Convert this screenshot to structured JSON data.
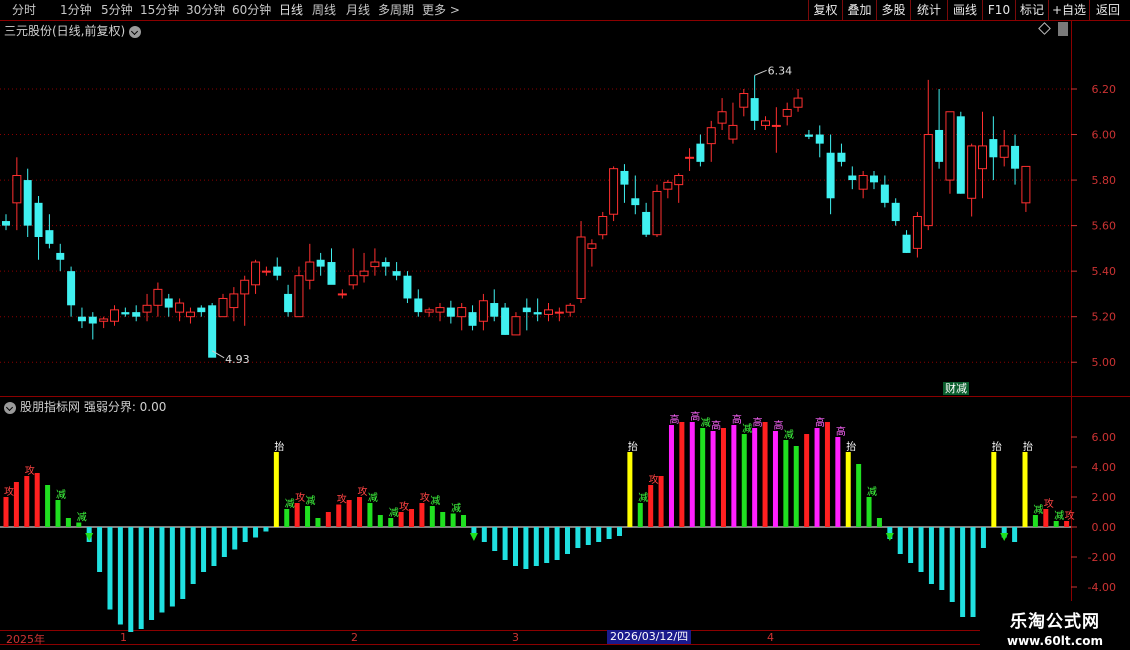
{
  "toolbar": {
    "periods": [
      "分时",
      "1分钟",
      "5分钟",
      "15分钟",
      "30分钟",
      "60分钟",
      "日线",
      "周线",
      "月线",
      "多周期",
      "更多 >"
    ],
    "active_period": "日线",
    "right_buttons": [
      "复权",
      "叠加",
      "多股",
      "统计",
      "画线",
      "F10",
      "标记",
      "+自选",
      "返回"
    ]
  },
  "chart": {
    "stock_title": "三元股份(日线,前复权)",
    "high_label": "6.34",
    "low_label": "4.93",
    "finance_tag": "财减",
    "price_ticks": [
      "6.20",
      "6.00",
      "5.80",
      "5.60",
      "5.40",
      "5.20",
      "5.00"
    ]
  },
  "indicator": {
    "title": "股朋指标网 强弱分界: 0.00",
    "ticks": [
      "6.00",
      "4.00",
      "2.00",
      "0.00",
      "-2.00",
      "-4.00"
    ],
    "labels": {
      "start": "抬",
      "attack": "攻",
      "reduce": "减",
      "high": "高"
    }
  },
  "datebar": {
    "labels": [
      "2025年",
      "1",
      "2",
      "3",
      "4"
    ],
    "selected_date": "2026/03/12/四"
  },
  "watermark": {
    "line1": "乐淘公式网",
    "line2": "www.60lt.com"
  },
  "colors": {
    "up": "#ff3030",
    "down": "#40f0f0",
    "grid": "#8b0000",
    "ind_red": "#ff2020",
    "ind_green": "#20e020",
    "ind_magenta": "#ff20ff",
    "ind_cyan": "#20e0e0",
    "ind_yellow": "#ffff00"
  },
  "chart_data": {
    "type": "candlestick",
    "ohlc": [
      [
        5.62,
        5.65,
        5.58,
        5.6
      ],
      [
        5.7,
        5.9,
        5.58,
        5.82
      ],
      [
        5.8,
        5.85,
        5.55,
        5.6
      ],
      [
        5.7,
        5.73,
        5.45,
        5.55
      ],
      [
        5.58,
        5.65,
        5.5,
        5.52
      ],
      [
        5.48,
        5.52,
        5.4,
        5.45
      ],
      [
        5.4,
        5.42,
        5.2,
        5.25
      ],
      [
        5.2,
        5.24,
        5.15,
        5.18
      ],
      [
        5.2,
        5.22,
        5.1,
        5.17
      ],
      [
        5.18,
        5.2,
        5.15,
        5.19
      ],
      [
        5.18,
        5.25,
        5.16,
        5.23
      ],
      [
        5.22,
        5.24,
        5.2,
        5.21
      ],
      [
        5.22,
        5.25,
        5.18,
        5.2
      ],
      [
        5.22,
        5.3,
        5.18,
        5.25
      ],
      [
        5.25,
        5.35,
        5.2,
        5.32
      ],
      [
        5.28,
        5.3,
        5.2,
        5.24
      ],
      [
        5.22,
        5.28,
        5.18,
        5.26
      ],
      [
        5.2,
        5.24,
        5.17,
        5.22
      ],
      [
        5.24,
        5.25,
        5.2,
        5.22
      ],
      [
        5.25,
        5.26,
        5.05,
        5.02
      ],
      [
        5.2,
        5.3,
        5.2,
        5.28
      ],
      [
        5.24,
        5.33,
        5.18,
        5.3
      ],
      [
        5.3,
        5.38,
        5.16,
        5.36
      ],
      [
        5.34,
        5.45,
        5.3,
        5.44
      ],
      [
        5.4,
        5.42,
        5.38,
        5.4
      ],
      [
        5.42,
        5.46,
        5.36,
        5.38
      ],
      [
        5.3,
        5.34,
        5.2,
        5.22
      ],
      [
        5.2,
        5.42,
        5.2,
        5.38
      ],
      [
        5.36,
        5.52,
        5.32,
        5.44
      ],
      [
        5.45,
        5.48,
        5.38,
        5.42
      ],
      [
        5.44,
        5.5,
        5.4,
        5.34
      ],
      [
        5.3,
        5.32,
        5.28,
        5.3
      ],
      [
        5.34,
        5.5,
        5.32,
        5.38
      ],
      [
        5.38,
        5.48,
        5.35,
        5.4
      ],
      [
        5.42,
        5.5,
        5.38,
        5.44
      ],
      [
        5.44,
        5.46,
        5.38,
        5.42
      ],
      [
        5.4,
        5.44,
        5.36,
        5.38
      ],
      [
        5.38,
        5.4,
        5.26,
        5.28
      ],
      [
        5.28,
        5.32,
        5.2,
        5.22
      ],
      [
        5.22,
        5.24,
        5.2,
        5.23
      ],
      [
        5.22,
        5.26,
        5.18,
        5.24
      ],
      [
        5.24,
        5.27,
        5.17,
        5.2
      ],
      [
        5.2,
        5.26,
        5.14,
        5.24
      ],
      [
        5.22,
        5.25,
        5.14,
        5.16
      ],
      [
        5.18,
        5.3,
        5.14,
        5.27
      ],
      [
        5.26,
        5.32,
        5.18,
        5.2
      ],
      [
        5.24,
        5.26,
        5.12,
        5.12
      ],
      [
        5.12,
        5.22,
        5.12,
        5.2
      ],
      [
        5.24,
        5.28,
        5.14,
        5.22
      ],
      [
        5.22,
        5.28,
        5.18,
        5.21
      ],
      [
        5.21,
        5.26,
        5.18,
        5.23
      ],
      [
        5.22,
        5.24,
        5.18,
        5.22
      ],
      [
        5.22,
        5.26,
        5.2,
        5.25
      ],
      [
        5.28,
        5.62,
        5.26,
        5.55
      ],
      [
        5.5,
        5.54,
        5.42,
        5.52
      ],
      [
        5.56,
        5.66,
        5.54,
        5.64
      ],
      [
        5.65,
        5.86,
        5.62,
        5.85
      ],
      [
        5.84,
        5.87,
        5.7,
        5.78
      ],
      [
        5.72,
        5.82,
        5.65,
        5.69
      ],
      [
        5.66,
        5.7,
        5.55,
        5.56
      ],
      [
        5.56,
        5.78,
        5.55,
        5.75
      ],
      [
        5.76,
        5.8,
        5.72,
        5.79
      ],
      [
        5.78,
        5.83,
        5.7,
        5.82
      ],
      [
        5.9,
        5.94,
        5.84,
        5.9
      ],
      [
        5.96,
        6.0,
        5.86,
        5.88
      ],
      [
        5.96,
        6.06,
        5.88,
        6.03
      ],
      [
        6.05,
        6.16,
        6.02,
        6.1
      ],
      [
        5.98,
        6.14,
        5.96,
        6.04
      ],
      [
        6.12,
        6.2,
        6.08,
        6.18
      ],
      [
        6.16,
        6.26,
        6.02,
        6.06
      ],
      [
        6.04,
        6.08,
        6.02,
        6.06
      ],
      [
        6.04,
        6.12,
        5.92,
        6.04
      ],
      [
        6.08,
        6.14,
        6.04,
        6.11
      ],
      [
        6.12,
        6.2,
        6.1,
        6.16
      ],
      [
        6.0,
        6.02,
        5.98,
        5.99
      ],
      [
        6.0,
        6.04,
        5.9,
        5.96
      ],
      [
        5.92,
        6.0,
        5.65,
        5.72
      ],
      [
        5.92,
        5.96,
        5.86,
        5.88
      ],
      [
        5.82,
        5.86,
        5.76,
        5.8
      ],
      [
        5.76,
        5.84,
        5.72,
        5.82
      ],
      [
        5.82,
        5.84,
        5.76,
        5.79
      ],
      [
        5.78,
        5.82,
        5.68,
        5.7
      ],
      [
        5.7,
        5.72,
        5.6,
        5.62
      ],
      [
        5.56,
        5.58,
        5.48,
        5.48
      ],
      [
        5.5,
        5.66,
        5.46,
        5.64
      ],
      [
        5.6,
        6.24,
        5.58,
        6.0
      ],
      [
        6.02,
        6.2,
        5.85,
        5.88
      ],
      [
        5.8,
        6.1,
        5.74,
        6.1
      ],
      [
        6.08,
        6.1,
        5.74,
        5.74
      ],
      [
        5.72,
        5.96,
        5.64,
        5.95
      ],
      [
        5.85,
        6.1,
        5.72,
        5.95
      ],
      [
        5.98,
        6.08,
        5.8,
        5.9
      ],
      [
        5.9,
        6.02,
        5.86,
        5.95
      ],
      [
        5.95,
        6.0,
        5.78,
        5.85
      ],
      [
        5.7,
        5.86,
        5.66,
        5.86
      ]
    ],
    "indicator_values": [
      2.0,
      3.0,
      3.4,
      3.6,
      2.8,
      1.8,
      0.6,
      0.3,
      -1.0,
      -3.0,
      -5.5,
      -6.5,
      -7.0,
      -6.8,
      -6.2,
      -5.7,
      -5.3,
      -4.8,
      -3.8,
      -3.0,
      -2.6,
      -2.0,
      -1.5,
      -1.0,
      -0.7,
      -0.3,
      5.0,
      1.2,
      1.6,
      1.4,
      0.6,
      1.0,
      1.5,
      1.8,
      2.0,
      1.6,
      0.8,
      0.6,
      1.0,
      1.2,
      1.6,
      1.4,
      1.0,
      0.9,
      0.8,
      -0.5,
      -1.0,
      -1.6,
      -2.2,
      -2.6,
      -2.8,
      -2.6,
      -2.4,
      -2.2,
      -1.8,
      -1.4,
      -1.2,
      -1.0,
      -0.8,
      -0.6,
      5.0,
      1.6,
      2.8,
      3.4,
      6.8,
      7.0,
      7.0,
      6.6,
      6.4,
      6.6,
      6.8,
      6.2,
      6.6,
      7.0,
      6.4,
      5.8,
      5.4,
      6.2,
      6.6,
      7.0,
      6.0,
      5.0,
      4.2,
      2.0,
      0.6,
      -0.8,
      -1.8,
      -2.4,
      -3.0,
      -3.8,
      -4.2,
      -5.0,
      -6.0,
      -6.0,
      -1.4,
      5.0,
      -0.7,
      -1.0,
      5.0,
      0.8,
      1.2,
      0.4,
      0.4
    ]
  }
}
